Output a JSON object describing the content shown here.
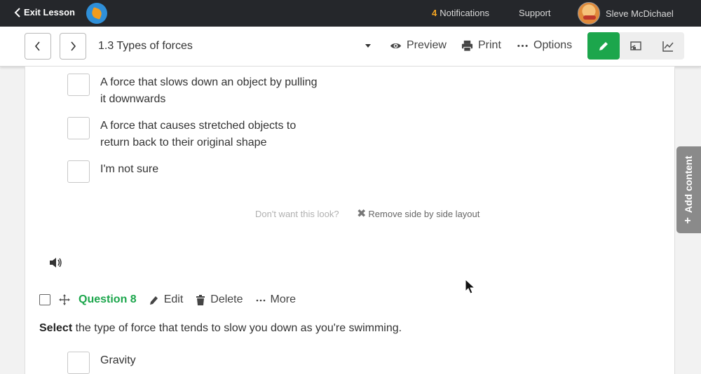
{
  "topbar": {
    "exit_label": "Exit Lesson",
    "notifications_count": "4",
    "notifications_label": "Notifications",
    "support_label": "Support",
    "user_name": "Sleve McDichael"
  },
  "toolbar": {
    "lesson_title": "1.3 Types of forces",
    "preview_label": "Preview",
    "print_label": "Print",
    "options_label": "Options",
    "active_mode": "edit",
    "accent_color": "#1ca64c"
  },
  "question7": {
    "options": [
      {
        "line1": "A force that slows down an object by pulling",
        "line2": "it downwards"
      },
      {
        "line1": "A force that causes stretched objects to",
        "line2": "return back to their original shape"
      },
      {
        "line1": "I'm not sure",
        "line2": ""
      }
    ],
    "layout_hint": "Don't want this look?",
    "remove_layout_label": "Remove side by side layout"
  },
  "question8": {
    "label": "Question 8",
    "edit_label": "Edit",
    "delete_label": "Delete",
    "more_label": "More",
    "prompt_bold": "Select",
    "prompt_rest": " the type of force that tends to slow you down as you're swimming.",
    "options": [
      {
        "text": "Gravity"
      }
    ]
  },
  "side_tab": {
    "label": "Add content"
  }
}
